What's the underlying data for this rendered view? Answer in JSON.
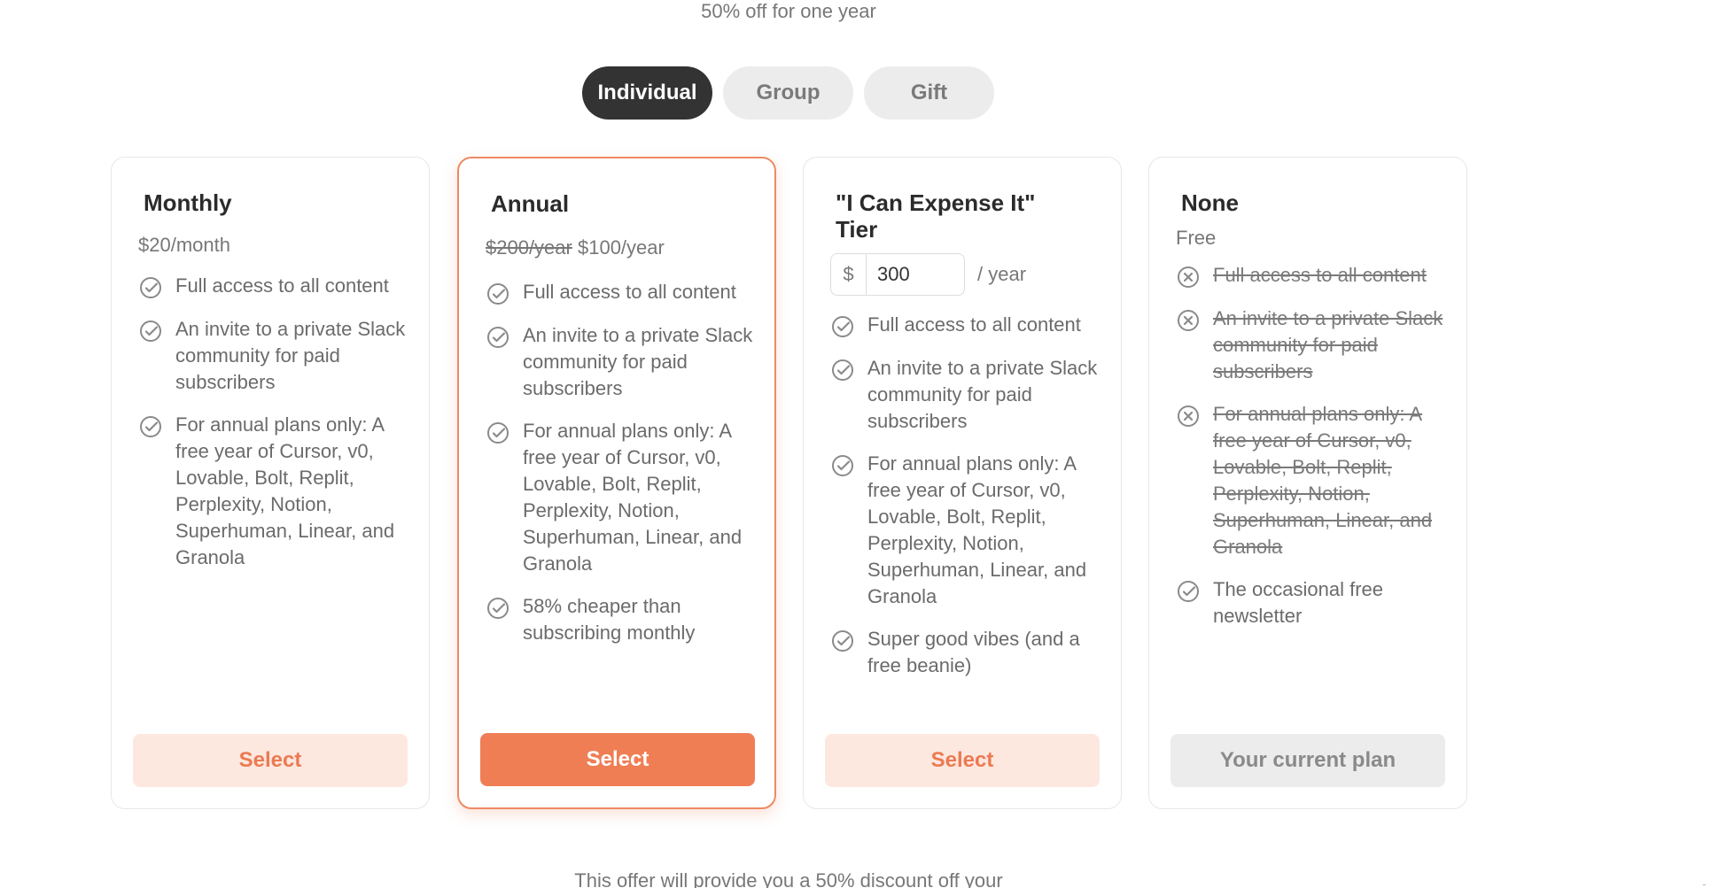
{
  "header": {
    "subtitle": "50% off for one year"
  },
  "tabs": [
    {
      "label": "Individual",
      "active": true
    },
    {
      "label": "Group",
      "active": false
    },
    {
      "label": "Gift",
      "active": false
    }
  ],
  "plans": [
    {
      "name": "Monthly",
      "price": "$20/month",
      "features": [
        {
          "text": "Full access to all content",
          "included": true
        },
        {
          "text": "An invite to a private Slack community for paid subscribers",
          "included": true
        },
        {
          "text": "For annual plans only: A free year of Cursor, v0, Lovable, Bolt, Replit, Perplexity, Notion, Superhuman, Linear, and Granola",
          "included": true
        }
      ],
      "button": "Select"
    },
    {
      "name": "Annual",
      "price_old": "$200/year",
      "price": "$100/year",
      "features": [
        {
          "text": "Full access to all content",
          "included": true
        },
        {
          "text": "An invite to a private Slack community for paid subscribers",
          "included": true
        },
        {
          "text": "For annual plans only: A free year of Cursor, v0, Lovable, Bolt, Replit, Perplexity, Notion, Superhuman, Linear, and Granola",
          "included": true
        },
        {
          "text": "58% cheaper than subscribing monthly",
          "included": true
        }
      ],
      "button": "Select"
    },
    {
      "name": "\"I Can Expense It\" Tier",
      "currency": "$",
      "amount": "300",
      "per": "/ year",
      "features": [
        {
          "text": "Full access to all content",
          "included": true
        },
        {
          "text": "An invite to a private Slack community for paid subscribers",
          "included": true
        },
        {
          "text": "For annual plans only: A free year of Cursor, v0, Lovable, Bolt, Replit, Perplexity, Notion, Superhuman, Linear, and Granola",
          "included": true
        },
        {
          "text": "Super good vibes (and a free beanie)",
          "included": true
        }
      ],
      "button": "Select"
    },
    {
      "name": "None",
      "price": "Free",
      "features": [
        {
          "text": "Full access to all content",
          "included": false
        },
        {
          "text": "An invite to a private Slack community for paid subscribers",
          "included": false
        },
        {
          "text": "For annual plans only: A free year of Cursor, v0, Lovable, Bolt, Replit, Perplexity, Notion, Superhuman, Linear, and Granola",
          "included": false
        },
        {
          "text": "The occasional free newsletter",
          "included": true
        }
      ],
      "button": "Your current plan"
    }
  ],
  "footer": {
    "text": "This offer will provide you a 50% discount off your"
  },
  "edge_mark": "-",
  "icons": {
    "included": "check-circle-icon",
    "excluded": "x-circle-icon"
  },
  "colors": {
    "accent": "#f07e55",
    "accent_light": "#fde8e0",
    "dark_tab": "#333333"
  }
}
